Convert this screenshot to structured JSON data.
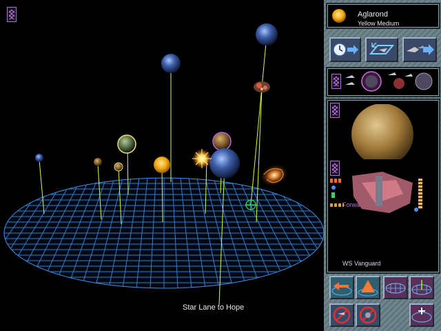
{
  "system": {
    "star_name": "Aglarond",
    "star_type": "Yellow Medium"
  },
  "planet_panel": {
    "title": "Forward Station"
  },
  "ship_panel": {
    "title": "WS Vanguard"
  },
  "map": {
    "lane_label": "Star Lane to Hope"
  },
  "colors": {
    "grid": "#2f7fd0",
    "stem": "#d8ff40",
    "frame": "#6a7f86",
    "knot": "#c070e0"
  },
  "icons": {
    "top_left_menu": "celtic-knot-icon",
    "clock_arrow": "clock-advance-icon",
    "center_view": "center-on-ship-icon",
    "ship_arrow": "fleet-advance-icon"
  }
}
